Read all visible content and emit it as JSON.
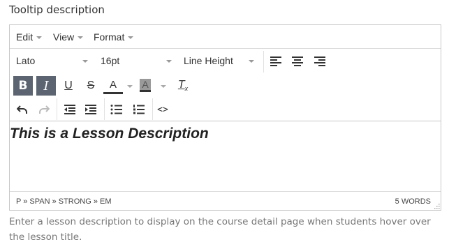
{
  "field": {
    "label": "Tooltip description",
    "help_text": "Enter a lesson description to display on the course detail page when students hover over the lesson title."
  },
  "menubar": {
    "items": [
      "Edit",
      "View",
      "Format"
    ]
  },
  "toolbar": {
    "font_family": "Lato",
    "font_size": "16pt",
    "line_height": "Line Height",
    "active_color": "#5b6470",
    "buttons": [
      "align-left-icon",
      "align-center-icon",
      "align-right-icon",
      "bold-icon",
      "italic-icon",
      "underline-icon",
      "strikethrough-icon",
      "text-color-icon",
      "background-color-icon",
      "clear-formatting-icon",
      "undo-icon",
      "redo-icon",
      "outdent-icon",
      "indent-icon",
      "bullet-list-icon",
      "numbered-list-icon",
      "source-code-icon"
    ],
    "bold_glyph": "B",
    "italic_glyph": "I",
    "underline_glyph": "U",
    "strike_glyph": "S",
    "text_color_glyph": "A",
    "bg_color_glyph": "A",
    "clear_glyph": "T",
    "clear_sub_glyph": "x",
    "source_glyph": "<>"
  },
  "content": {
    "text": "This is a Lesson Description"
  },
  "statusbar": {
    "path": "P » SPAN » STRONG » EM",
    "word_count": "5 WORDS"
  }
}
